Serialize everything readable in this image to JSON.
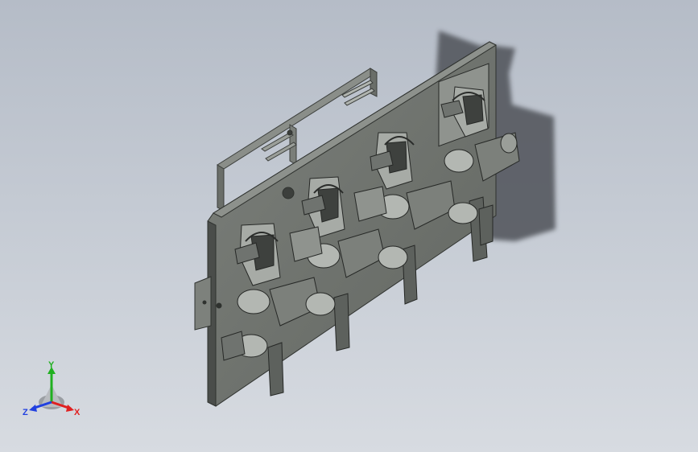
{
  "viewport": {
    "background_top": "#b5bcc7",
    "background_bottom": "#d7dbe1",
    "model_colors": {
      "plate_face": "#6f736f",
      "plate_edge": "#4a4d4a",
      "frame": "#7a7e79",
      "part_light": "#a6aaa5",
      "part_dark": "#3d403d",
      "shadow": "#5b5f66"
    }
  },
  "triad": {
    "x_label": "X",
    "y_label": "Y",
    "z_label": "Z",
    "x_color": "#e02020",
    "y_color": "#20b020",
    "z_color": "#2040e0"
  }
}
